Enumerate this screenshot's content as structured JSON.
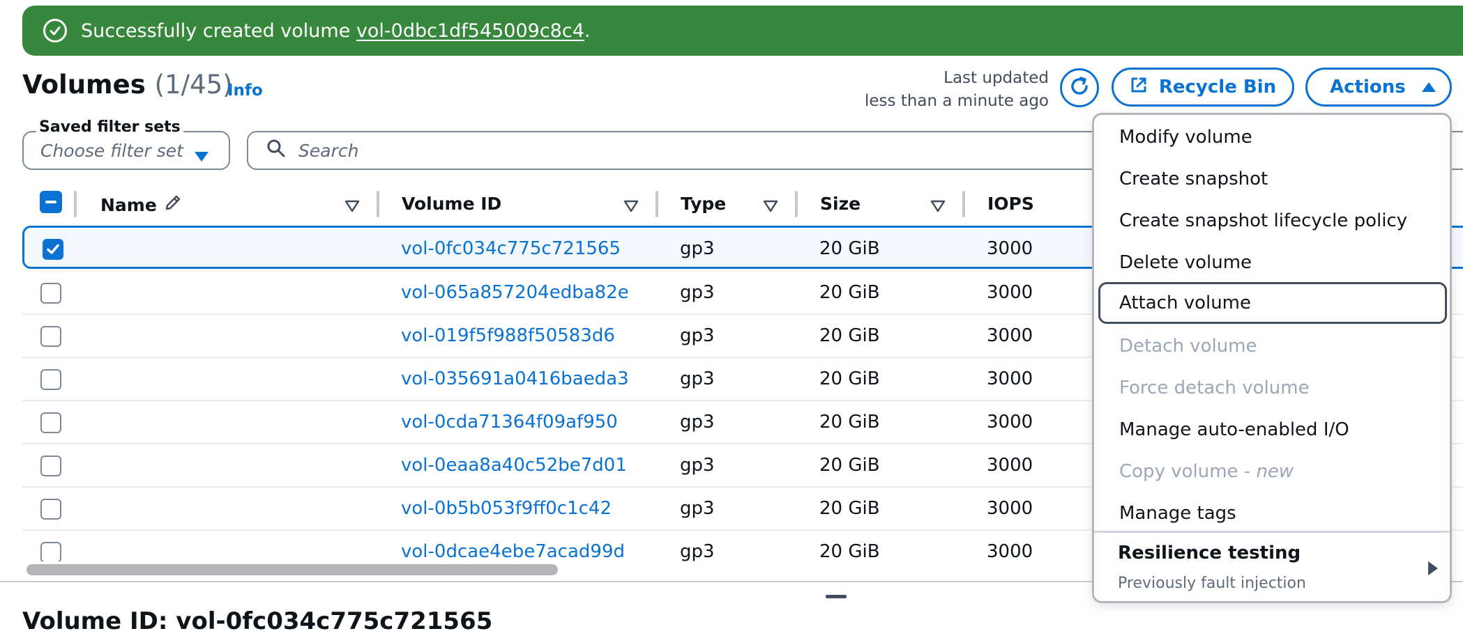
{
  "flash": {
    "prefix": "Successfully created volume ",
    "volume_link": "vol-0dbc1df545009c8c4",
    "suffix": "."
  },
  "header": {
    "title": "Volumes",
    "count": "(1/45)",
    "info": "Info",
    "last_updated_label": "Last updated",
    "last_updated_value": "less than a minute ago",
    "recycle_bin": "Recycle Bin",
    "actions": "Actions"
  },
  "filters": {
    "saved_label": "Saved filter sets",
    "saved_placeholder": "Choose filter set",
    "search_placeholder": "Search"
  },
  "table": {
    "columns": [
      "Name",
      "Volume ID",
      "Type",
      "Size",
      "IOPS"
    ],
    "rows": [
      {
        "id": "vol-0fc034c775c721565",
        "type": "gp3",
        "size": "20 GiB",
        "iops": "3000",
        "selected": true
      },
      {
        "id": "vol-065a857204edba82e",
        "type": "gp3",
        "size": "20 GiB",
        "iops": "3000",
        "selected": false
      },
      {
        "id": "vol-019f5f988f50583d6",
        "type": "gp3",
        "size": "20 GiB",
        "iops": "3000",
        "selected": false
      },
      {
        "id": "vol-035691a0416baeda3",
        "type": "gp3",
        "size": "20 GiB",
        "iops": "3000",
        "selected": false
      },
      {
        "id": "vol-0cda71364f09af950",
        "type": "gp3",
        "size": "20 GiB",
        "iops": "3000",
        "selected": false
      },
      {
        "id": "vol-0eaa8a40c52be7d01",
        "type": "gp3",
        "size": "20 GiB",
        "iops": "3000",
        "selected": false
      },
      {
        "id": "vol-0b5b053f9ff0c1c42",
        "type": "gp3",
        "size": "20 GiB",
        "iops": "3000",
        "selected": false
      },
      {
        "id": "vol-0dcae4ebe7acad99d",
        "type": "gp3",
        "size": "20 GiB",
        "iops": "3000",
        "selected": false
      }
    ]
  },
  "actions_menu": {
    "items": [
      {
        "label": "Modify volume",
        "disabled": false
      },
      {
        "label": "Create snapshot",
        "disabled": false
      },
      {
        "label": "Create snapshot lifecycle policy",
        "disabled": false
      },
      {
        "label": "Delete volume",
        "disabled": false
      },
      {
        "label": "Attach volume",
        "disabled": false,
        "focused": true
      },
      {
        "label": "Detach volume",
        "disabled": true
      },
      {
        "label": "Force detach volume",
        "disabled": true
      },
      {
        "label": "Manage auto-enabled I/O",
        "disabled": false
      },
      {
        "label": "Copy volume - ",
        "badge": "new",
        "disabled": true
      },
      {
        "label": "Manage tags",
        "disabled": false
      }
    ],
    "submenu": {
      "title": "Resilience testing",
      "description": "Previously fault injection"
    }
  },
  "detail": {
    "title": "Volume ID: vol-0fc034c775c721565"
  },
  "colors": {
    "accent": "#0972d3",
    "success": "#37873d",
    "disabled": "#9ba7b6"
  }
}
